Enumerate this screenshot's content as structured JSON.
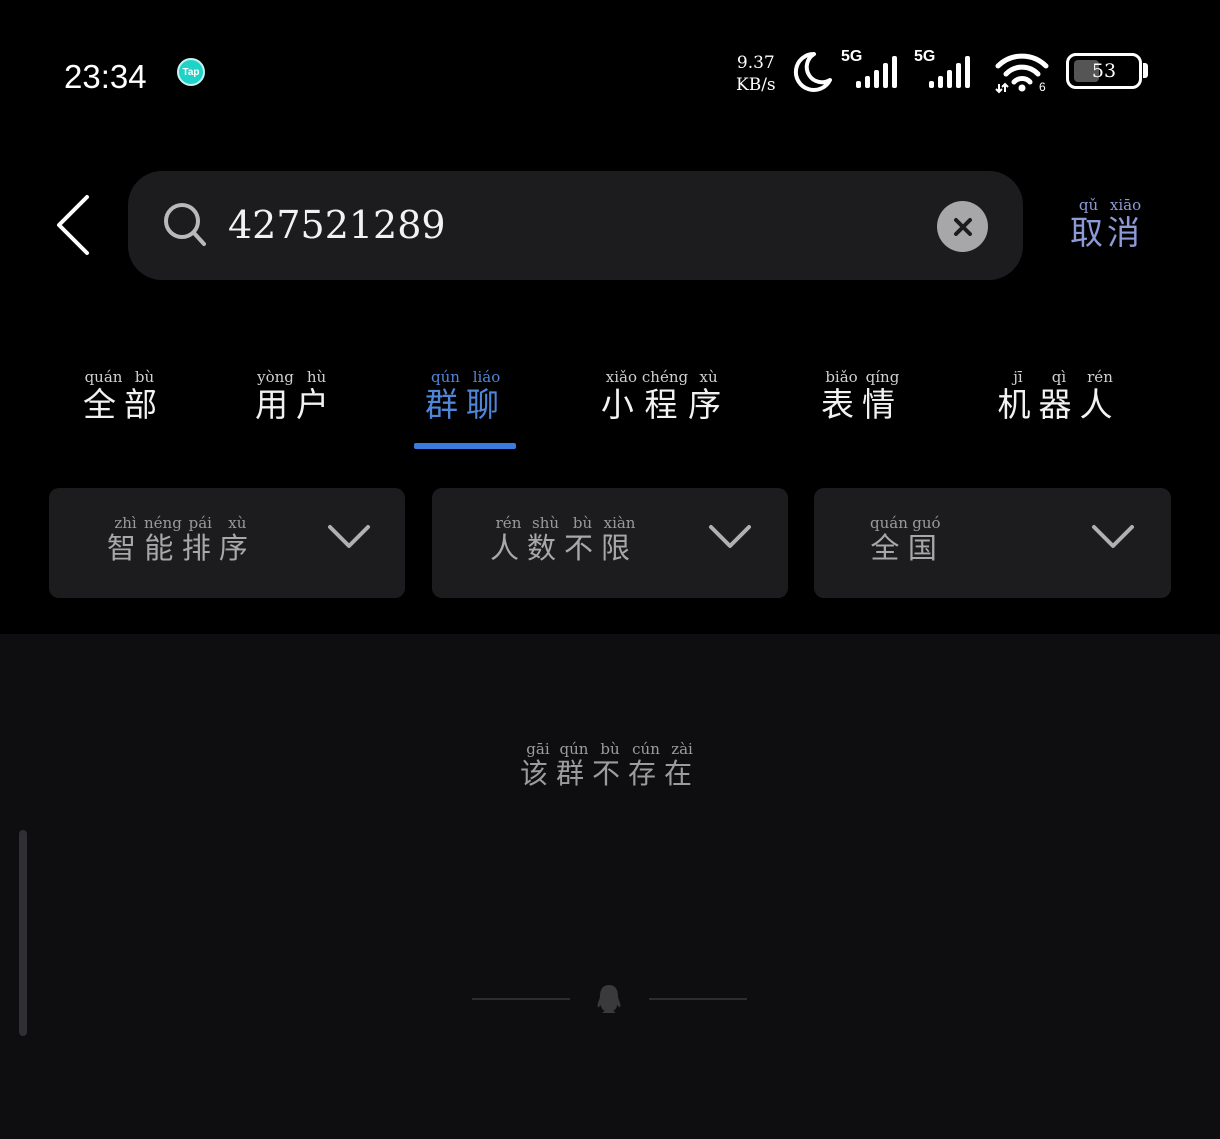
{
  "status_bar": {
    "time": "23:34",
    "app_badge": "Tap",
    "net_speed_value": "9.37",
    "net_speed_unit": "KB/s",
    "sim1_generation": "5G",
    "sim2_generation": "5G",
    "wifi_label": "6",
    "battery_level": "53"
  },
  "search": {
    "query": "427521289",
    "placeholder": ""
  },
  "cancel": [
    {
      "char": "取",
      "pinyin": "qǔ"
    },
    {
      "char": "消",
      "pinyin": "xiāo"
    }
  ],
  "tabs": [
    {
      "chars": [
        {
          "char": "全",
          "pinyin": "quán"
        },
        {
          "char": "部",
          "pinyin": "bù"
        }
      ],
      "active": false
    },
    {
      "chars": [
        {
          "char": "用",
          "pinyin": "yòng"
        },
        {
          "char": "户",
          "pinyin": "hù"
        }
      ],
      "active": false
    },
    {
      "chars": [
        {
          "char": "群",
          "pinyin": "qún"
        },
        {
          "char": "聊",
          "pinyin": "liáo"
        }
      ],
      "active": true
    },
    {
      "chars": [
        {
          "char": "小",
          "pinyin": "xiǎo"
        },
        {
          "char": "程",
          "pinyin": "chéng"
        },
        {
          "char": "序",
          "pinyin": "xù"
        }
      ],
      "active": false
    },
    {
      "chars": [
        {
          "char": "表",
          "pinyin": "biǎo"
        },
        {
          "char": "情",
          "pinyin": "qíng"
        }
      ],
      "active": false
    },
    {
      "chars": [
        {
          "char": "机",
          "pinyin": "jī"
        },
        {
          "char": "器",
          "pinyin": "qì"
        },
        {
          "char": "人",
          "pinyin": "rén"
        }
      ],
      "active": false
    }
  ],
  "filters": [
    {
      "chars": [
        {
          "char": "智",
          "pinyin": "zhì"
        },
        {
          "char": "能",
          "pinyin": "néng"
        },
        {
          "char": "排",
          "pinyin": "pái"
        },
        {
          "char": "序",
          "pinyin": "xù"
        }
      ]
    },
    {
      "chars": [
        {
          "char": "人",
          "pinyin": "rén"
        },
        {
          "char": "数",
          "pinyin": "shù"
        },
        {
          "char": "不",
          "pinyin": "bù"
        },
        {
          "char": "限",
          "pinyin": "xiàn"
        }
      ]
    },
    {
      "chars": [
        {
          "char": "全",
          "pinyin": "quán"
        },
        {
          "char": "国",
          "pinyin": "guó"
        }
      ]
    }
  ],
  "empty_message": [
    {
      "char": "该",
      "pinyin": "gāi"
    },
    {
      "char": "群",
      "pinyin": "qún"
    },
    {
      "char": "不",
      "pinyin": "bù"
    },
    {
      "char": "存",
      "pinyin": "cún"
    },
    {
      "char": "在",
      "pinyin": "zài"
    }
  ],
  "colors": {
    "accent": "#3b7be0",
    "accent_text": "#4f86d8",
    "cancel_text": "#8d9ad8",
    "background": "#000000",
    "surface": "#1c1c1e"
  }
}
